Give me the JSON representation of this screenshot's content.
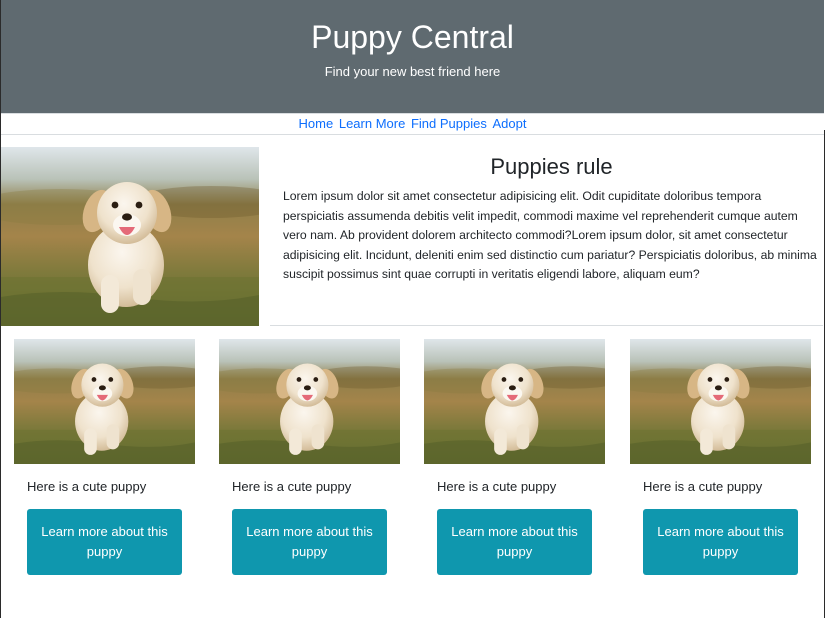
{
  "hero": {
    "title": "Puppy Central",
    "subtitle": "Find your new best friend here"
  },
  "nav": {
    "items": [
      {
        "label": "Home"
      },
      {
        "label": "Learn More"
      },
      {
        "label": "Find Puppies"
      },
      {
        "label": "Adopt"
      }
    ]
  },
  "feature": {
    "image_alt": "puppy-photo",
    "heading": "Puppies rule",
    "body": "Lorem ipsum dolor sit amet consectetur adipisicing elit. Odit cupiditate doloribus tempora perspiciatis assumenda debitis velit impedit, commodi maxime vel reprehenderit cumque autem vero nam. Ab provident dolorem architecto commodi?Lorem ipsum dolor, sit amet consectetur adipisicing elit. Incidunt, deleniti enim sed distinctio cum pariatur? Perspiciatis doloribus, ab minima suscipit possimus sint quae corrupti in veritatis eligendi labore, aliquam eum?"
  },
  "cards": [
    {
      "caption": "Here is a cute puppy",
      "button": "Learn more about this puppy"
    },
    {
      "caption": "Here is a cute puppy",
      "button": "Learn more about this puppy"
    },
    {
      "caption": "Here is a cute puppy",
      "button": "Learn more about this puppy"
    },
    {
      "caption": "Here is a cute puppy",
      "button": "Learn more about this puppy"
    }
  ],
  "colors": {
    "hero_bg": "#5f6a70",
    "link": "#0d6efd",
    "button_bg": "#0f97ae"
  }
}
